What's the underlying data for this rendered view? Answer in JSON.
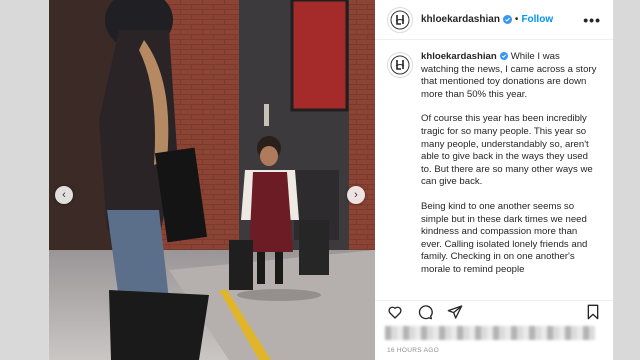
{
  "post": {
    "username": "khloekardashian",
    "follow_label": "Follow",
    "separator": "•",
    "more_label": "•••",
    "caption": {
      "username": "khloekardashian",
      "paragraphs": [
        "While I was watching the news, I came across a story that mentioned toy donations are down more than 50% this year.",
        "Of course this year has been incredibly tragic for so many people. This year so many people, understandably so, aren't able to give back in the ways they used to. But there are so many other ways we can give back.",
        "Being kind to one another seems so simple but in these dark times we need kindness and compassion more than ever. Calling isolated lonely friends and family. Checking in on one another's morale to remind people"
      ]
    },
    "timestamp": "16 HOURS AGO",
    "nav": {
      "prev": "‹",
      "next": "›"
    }
  },
  "icons": {
    "like": "heart-icon",
    "comment": "comment-icon",
    "share": "share-icon",
    "save": "bookmark-icon",
    "verified": "verified-badge-icon"
  },
  "colors": {
    "link_blue": "#0095f6",
    "text": "#262626",
    "muted": "#8e8e8e"
  }
}
